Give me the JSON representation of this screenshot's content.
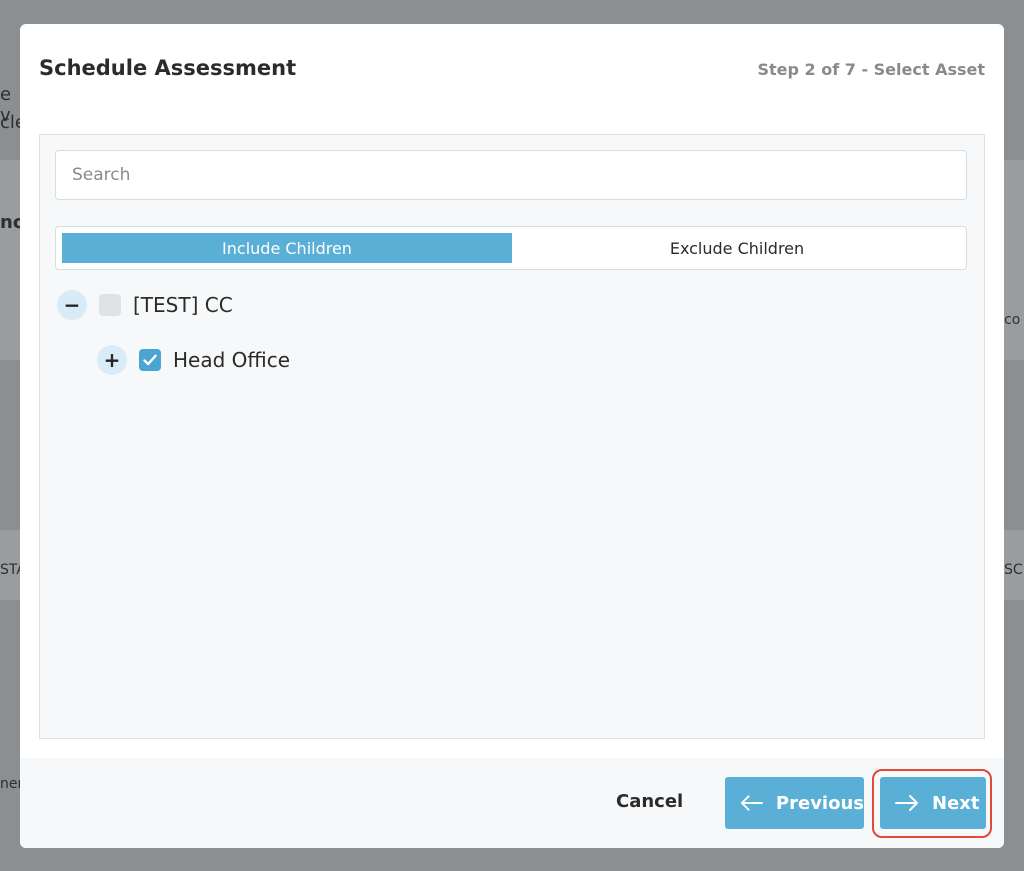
{
  "background": {
    "fragments": [
      "e v",
      "cle",
      "nc",
      "STA",
      "SCH",
      "co",
      "ner"
    ]
  },
  "modal": {
    "title": "Schedule Assessment",
    "step": "Step 2 of 7 - Select Asset"
  },
  "search": {
    "placeholder": "Search",
    "value": ""
  },
  "toggle": {
    "include_label": "Include Children",
    "exclude_label": "Exclude Children",
    "selected": "include"
  },
  "tree": {
    "root": {
      "expander": "−",
      "label": "[TEST] CC",
      "checked": false
    },
    "child": {
      "expander": "+",
      "label": "Head Office",
      "checked": true
    }
  },
  "footer": {
    "cancel_label": "Cancel",
    "previous_label": "Previous",
    "next_label": "Next"
  },
  "colors": {
    "accent": "#5aafd6",
    "highlight": "#e04a3a"
  },
  "icons": {
    "previous": "arrow-left-icon",
    "next": "arrow-right-icon",
    "check": "check-icon"
  }
}
